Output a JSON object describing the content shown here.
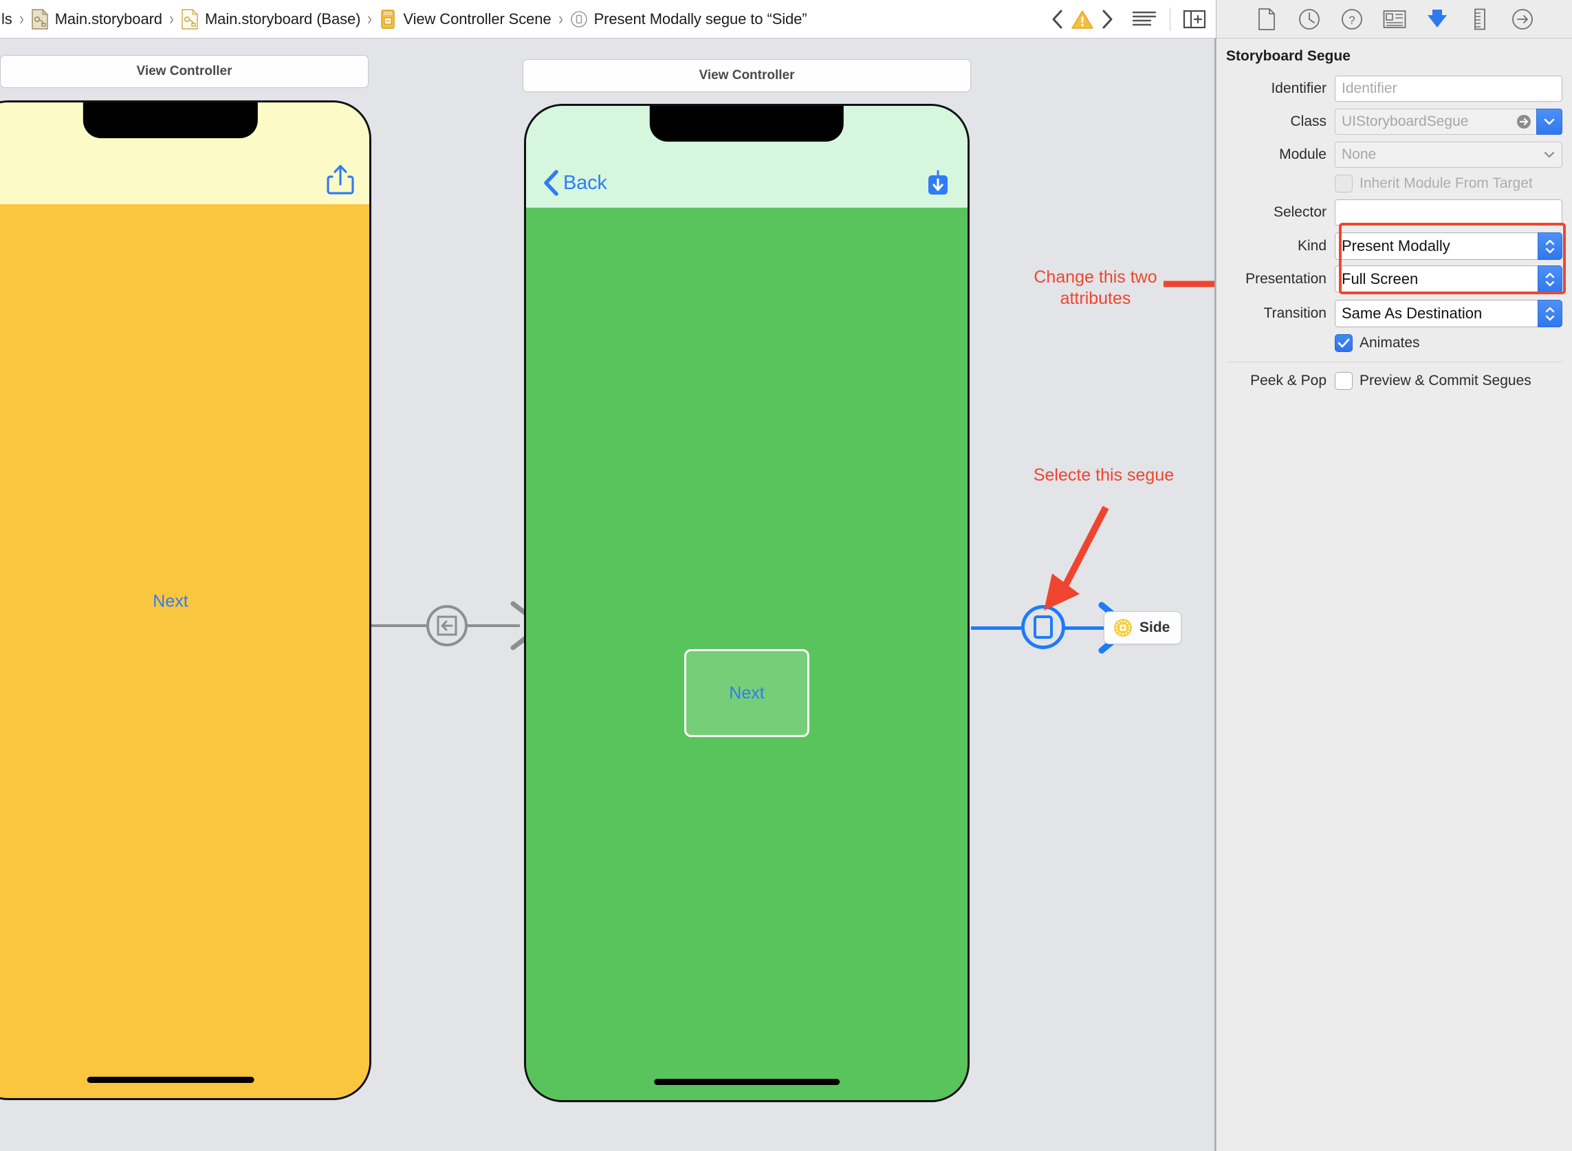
{
  "jumpbar": {
    "breadcrumb": [
      {
        "label": "ls",
        "icon": "none"
      },
      {
        "label": "Main.storyboard",
        "icon": "storyboard-file-icon"
      },
      {
        "label": "Main.storyboard (Base)",
        "icon": "storyboard-file-icon"
      },
      {
        "label": "View Controller Scene",
        "icon": "view-controller-scene-icon"
      },
      {
        "label": "Present Modally segue to “Side”",
        "icon": "segue-icon"
      }
    ],
    "separator": "›",
    "prev_issue_label": "‹",
    "next_issue_label": "›",
    "warning_icon": "warning-triangle-icon",
    "outline_icon": "document-items-icon",
    "panel_icon": "show-inspector-icon"
  },
  "canvas": {
    "scenes": [
      {
        "id": "scene-yellow",
        "title": "View Controller",
        "nav_bg": "#fcfbc8",
        "body_bg": "#fbc63f",
        "center_label": "Next",
        "center_label_color": "#2f7cf6",
        "right_bar_icon": "share-icon",
        "right_bar_icon_color": "#2f7cf6",
        "has_back_button": false,
        "back_label": ""
      },
      {
        "id": "scene-green",
        "title": "View Controller",
        "nav_bg": "#d6f7de",
        "body_bg": "#5ac45c",
        "center_label": "",
        "center_label_color": "#2f7cf6",
        "right_bar_icon": "download-icon",
        "right_bar_icon_color": "#2f7cf6",
        "has_back_button": true,
        "back_label": "Back",
        "button_label": "Next"
      }
    ],
    "segues": [
      {
        "id": "segue-show",
        "icon": "show-segue-icon",
        "color": "#8e8e8e",
        "selected": false
      },
      {
        "id": "segue-present-modally",
        "icon": "modal-segue-icon",
        "color": "#1d7bfb",
        "selected": true
      }
    ],
    "exit_badge": {
      "label": "Side",
      "icon": "exit-placeholder-icon"
    },
    "annotations": [
      {
        "id": "annot-change-attributes",
        "text": "Change this two\nattributes",
        "color": "#ef4530"
      },
      {
        "id": "annot-select-segue",
        "text": "Selecte this segue",
        "color": "#ef4530"
      }
    ]
  },
  "inspector": {
    "tabs": [
      {
        "name": "file-inspector-icon",
        "active": false
      },
      {
        "name": "history-inspector-icon",
        "active": false
      },
      {
        "name": "quick-help-inspector-icon",
        "active": false
      },
      {
        "name": "identity-inspector-icon",
        "active": false
      },
      {
        "name": "attributes-inspector-icon",
        "active": true
      },
      {
        "name": "size-inspector-icon",
        "active": false
      },
      {
        "name": "connections-inspector-icon",
        "active": false
      }
    ],
    "section_title": "Storyboard Segue",
    "identifier": {
      "label": "Identifier",
      "value": "",
      "placeholder": "Identifier"
    },
    "class": {
      "label": "Class",
      "value": "",
      "placeholder": "UIStoryboardSegue"
    },
    "module": {
      "label": "Module",
      "value": "",
      "placeholder": "None"
    },
    "inherit_module": {
      "label": "Inherit Module From Target",
      "checked": false,
      "enabled": false
    },
    "selector": {
      "label": "Selector",
      "value": "",
      "placeholder": ""
    },
    "kind": {
      "label": "Kind",
      "value": "Present Modally"
    },
    "presentation": {
      "label": "Presentation",
      "value": "Full Screen"
    },
    "transition": {
      "label": "Transition",
      "value": "Same As Destination"
    },
    "animates": {
      "label": "Animates",
      "checked": true
    },
    "peek_and_pop": {
      "label": "Peek & Pop",
      "option_label": "Preview & Commit Segues",
      "checked": false
    }
  },
  "colors": {
    "accent_blue": "#2f78ef",
    "annotation_red": "#ef4530",
    "canvas_bg": "#e2e4e7",
    "inspector_bg": "#ececec"
  }
}
